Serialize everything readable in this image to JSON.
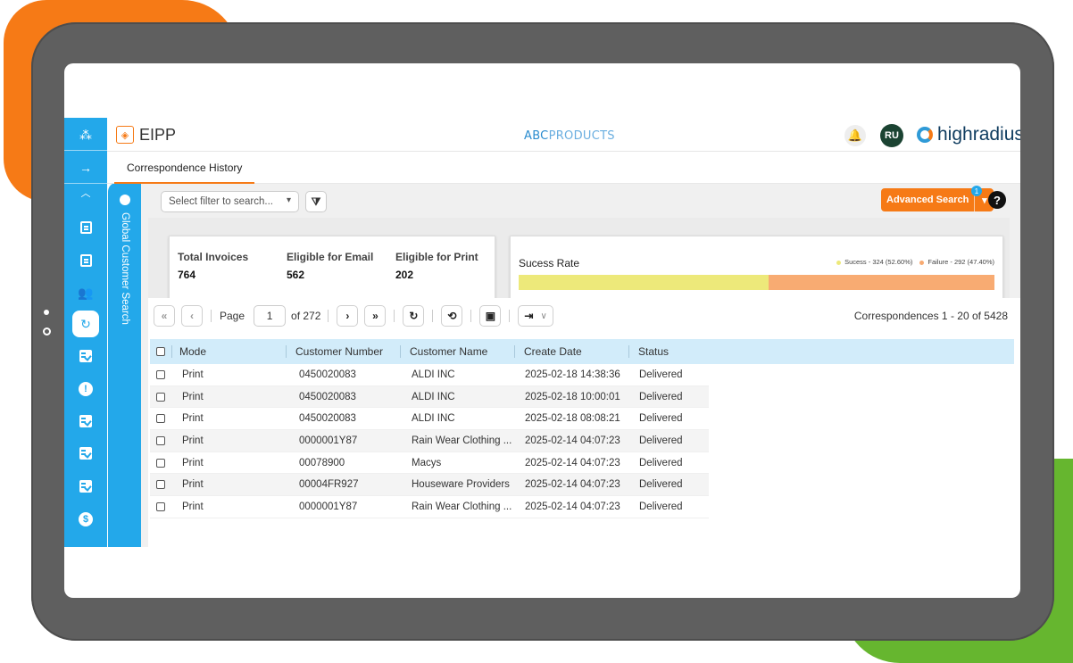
{
  "app": {
    "name": "EIPP",
    "brand_center_bold": "ABC",
    "brand_center_light": "PRODUCTS",
    "user_initials": "RU",
    "vendor_logo": "highradius"
  },
  "sidebar": {
    "items": [
      {
        "icon": "apps-grid-icon"
      },
      {
        "icon": "arrow-right-icon"
      },
      {
        "icon": "chevron-up-icon"
      },
      {
        "icon": "invoice-icon"
      },
      {
        "icon": "no-invoice-icon"
      },
      {
        "icon": "user-settings-icon"
      },
      {
        "icon": "correspondence-history-icon",
        "active": true
      },
      {
        "icon": "checklist-icon"
      },
      {
        "icon": "alert-icon"
      },
      {
        "icon": "checklist-icon"
      },
      {
        "icon": "checklist-icon"
      },
      {
        "icon": "checklist-icon"
      },
      {
        "icon": "payment-icon"
      }
    ],
    "global_search_label": "Global Customer Search"
  },
  "tabs": [
    {
      "label": "Correspondence History",
      "active": true
    }
  ],
  "toolbar": {
    "filter_placeholder": "Select filter to search...",
    "advanced_search_label": "Advanced Search",
    "advanced_search_badge": "1",
    "help_symbol": "?"
  },
  "stats": {
    "total_invoices_label": "Total Invoices",
    "total_invoices_value": "764",
    "eligible_email_label": "Eligible for Email",
    "eligible_email_value": "562",
    "eligible_print_label": "Eligible for Print",
    "eligible_print_value": "202"
  },
  "success_rate": {
    "title": "Sucess Rate",
    "success_legend": "Sucess - 324 (52.60%)",
    "failure_legend": "Failure - 292 (47.40%)",
    "success_fraction": 0.526,
    "success_color": "#ede97a",
    "failure_color": "#f8ab72"
  },
  "pager": {
    "page_label": "Page",
    "page_value": "1",
    "of_label": "of 272",
    "range_text": "Correspondences 1 - 20 of 5428"
  },
  "table": {
    "columns": [
      "Mode",
      "Customer Number",
      "Customer Name",
      "Create Date",
      "Status"
    ],
    "rows": [
      [
        "Print",
        "0450020083",
        "ALDI INC",
        "2025-02-18 14:38:36",
        "Delivered"
      ],
      [
        "Print",
        "0450020083",
        "ALDI INC",
        "2025-02-18 10:00:01",
        "Delivered"
      ],
      [
        "Print",
        "0450020083",
        "ALDI INC",
        "2025-02-18 08:08:21",
        "Delivered"
      ],
      [
        "Print",
        "0000001Y87",
        "Rain Wear Clothing ...",
        "2025-02-14 04:07:23",
        "Delivered"
      ],
      [
        "Print",
        "00078900",
        "Macys",
        "2025-02-14 04:07:23",
        "Delivered"
      ],
      [
        "Print",
        "00004FR927",
        "Houseware Providers",
        "2025-02-14 04:07:23",
        "Delivered"
      ],
      [
        "Print",
        "0000001Y87",
        "Rain Wear Clothing ...",
        "2025-02-14 04:07:23",
        "Delivered"
      ]
    ]
  },
  "colors": {
    "accent_orange": "#f67a16",
    "rail_blue": "#23a8ea",
    "header_row": "#d2ecfa",
    "decor_green": "#66b62f"
  }
}
